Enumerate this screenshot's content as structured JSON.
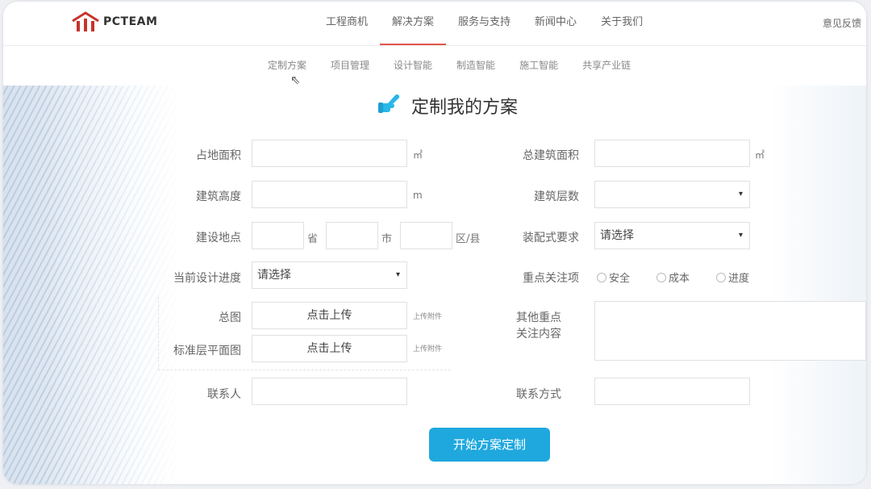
{
  "brand": {
    "name": "PCTEAM"
  },
  "nav": {
    "items": [
      "工程商机",
      "解决方案",
      "服务与支持",
      "新闻中心",
      "关于我们"
    ],
    "active_index": 1,
    "feedback": "意见反馈"
  },
  "subnav": {
    "items": [
      "定制方案",
      "项目管理",
      "设计智能",
      "制造智能",
      "施工智能",
      "共享产业链"
    ]
  },
  "form": {
    "title": "定制我的方案",
    "land_area": {
      "label": "占地面积",
      "value": "",
      "unit": "㎡"
    },
    "total_area": {
      "label": "总建筑面积",
      "value": "",
      "unit": "㎡"
    },
    "height": {
      "label": "建筑高度",
      "value": "",
      "unit": "m"
    },
    "floors": {
      "label": "建筑层数",
      "value": ""
    },
    "location": {
      "label": "建设地点",
      "province_unit": "省",
      "city_unit": "市",
      "district_unit": "区/县"
    },
    "prefab": {
      "label": "装配式要求",
      "value": "请选择"
    },
    "progress": {
      "label": "当前设计进度",
      "value": "请选择"
    },
    "focus": {
      "label": "重点关注项",
      "options": [
        "安全",
        "成本",
        "进度"
      ]
    },
    "drawing": {
      "label": "总图",
      "button": "点击上传",
      "hint": "上传附件"
    },
    "floor_plan": {
      "label": "标准层平面图",
      "button": "点击上传",
      "hint": "上传附件"
    },
    "other": {
      "label_line1": "其他重点",
      "label_line2": "关注内容"
    },
    "contact": {
      "label": "联系人",
      "value": ""
    },
    "contact_method": {
      "label": "联系方式",
      "value": ""
    },
    "submit": "开始方案定制"
  },
  "colors": {
    "accent": "#1fa8de",
    "brand": "#c8332b",
    "active_tab": "#e2574c"
  }
}
